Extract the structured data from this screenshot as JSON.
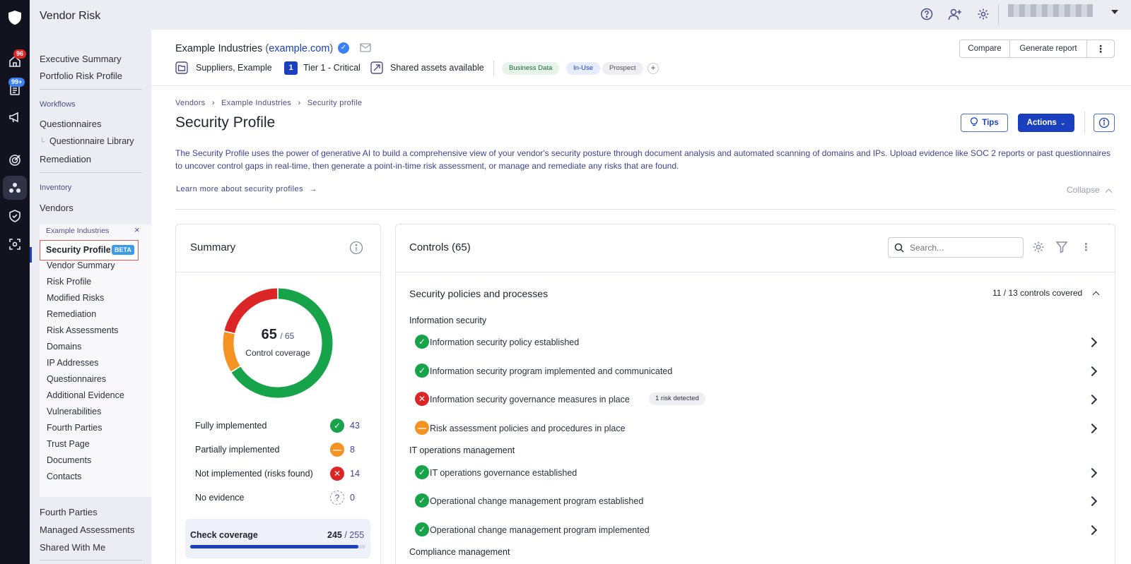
{
  "app": {
    "title": "Vendor Risk"
  },
  "rail": {
    "home_badge": "96",
    "docs_badge": "99+",
    "icons": [
      "logo-shield-icon",
      "home-icon",
      "clipboard-icon",
      "megaphone-icon",
      "target-icon",
      "vendors-icon",
      "shield-check-icon",
      "scan-icon"
    ]
  },
  "sidebar": {
    "items_top": [
      "Executive Summary",
      "Portfolio Risk Profile"
    ],
    "workflows_heading": "Workflows",
    "workflows": [
      "Questionnaires",
      "Questionnaire Library",
      "Remediation"
    ],
    "inventory_heading": "Inventory",
    "inventory": [
      "Vendors"
    ],
    "vendor_context": "Example Industries",
    "active_item": "Security Profile",
    "active_badge": "BETA",
    "vendor_items": [
      "Vendor Summary",
      "Risk Profile",
      "Modified Risks",
      "Remediation",
      "Risk Assessments",
      "Domains",
      "IP Addresses",
      "Questionnaires",
      "Additional Evidence",
      "Vulnerabilities",
      "Fourth Parties",
      "Trust Page",
      "Documents",
      "Contacts"
    ],
    "items_bottom": [
      "Fourth Parties",
      "Managed Assessments",
      "Shared With Me"
    ]
  },
  "vendor": {
    "name": "Example Industries",
    "domain": "example.com",
    "portfolio": "Suppliers, Example",
    "tier_number": "1",
    "tier_label": "Tier 1 - Critical",
    "shared_assets": "Shared assets available",
    "labels": [
      {
        "text": "Business Data",
        "bg": "#e6f4ea",
        "fg": "#1e6b35"
      },
      {
        "text": "In-Use",
        "bg": "#e5ecfb",
        "fg": "#1a3fbf"
      },
      {
        "text": "Prospect",
        "bg": "#efeff3",
        "fg": "#4b4f5f"
      }
    ]
  },
  "header_buttons": {
    "compare": "Compare",
    "generate_report": "Generate report"
  },
  "breadcrumb": [
    "Vendors",
    "Example Industries",
    "Security profile"
  ],
  "page": {
    "title": "Security Profile",
    "tips": "Tips",
    "actions": "Actions",
    "description": "The Security Profile uses the power of generative AI to build a comprehensive view of your vendor's security posture through document analysis and automated scanning of domains and IPs. Upload evidence like SOC 2 reports or past questionnaires to uncover control gaps in real-time, then generate a point-in-time risk assessment, or manage and remediate any risks that are found.",
    "learn_more": "Learn more about security profiles",
    "collapse": "Collapse"
  },
  "summary": {
    "title": "Summary",
    "coverage_value": "65",
    "coverage_total": "/ 65",
    "coverage_label": "Control coverage",
    "rows": [
      {
        "label": "Fully implemented",
        "value": "43",
        "status": "ok"
      },
      {
        "label": "Partially implemented",
        "value": "8",
        "status": "part"
      },
      {
        "label": "Not implemented (risks found)",
        "value": "14",
        "status": "bad"
      },
      {
        "label": "No evidence",
        "value": "0",
        "status": "none"
      }
    ],
    "donut": {
      "fully": 43,
      "partial": 8,
      "not_implemented": 14,
      "no_evidence": 0
    },
    "check_coverage_label": "Check coverage",
    "check_coverage_value": "245",
    "check_coverage_total": "/ 255",
    "check_coverage_fraction": 0.961,
    "colors": {
      "ok": "#16a34a",
      "part": "#f59322",
      "bad": "#dc2626"
    }
  },
  "controls": {
    "title": "Controls (65)",
    "search_placeholder": "Search...",
    "group_title": "Security policies and processes",
    "group_coverage": "11 / 13 controls covered",
    "sections": [
      {
        "heading": "Information security",
        "items": [
          {
            "label": "Information security policy established",
            "status": "ok"
          },
          {
            "label": "Information security program implemented and communicated",
            "status": "ok"
          },
          {
            "label": "Information security governance measures in place",
            "status": "bad",
            "tag": "1 risk detected"
          },
          {
            "label": "Risk assessment policies and procedures in place",
            "status": "part"
          }
        ]
      },
      {
        "heading": "IT operations management",
        "items": [
          {
            "label": "IT operations governance established",
            "status": "ok"
          },
          {
            "label": "Operational change management program established",
            "status": "ok"
          },
          {
            "label": "Operational change management program implemented",
            "status": "ok"
          }
        ]
      },
      {
        "heading": "Compliance management",
        "items": []
      }
    ]
  }
}
